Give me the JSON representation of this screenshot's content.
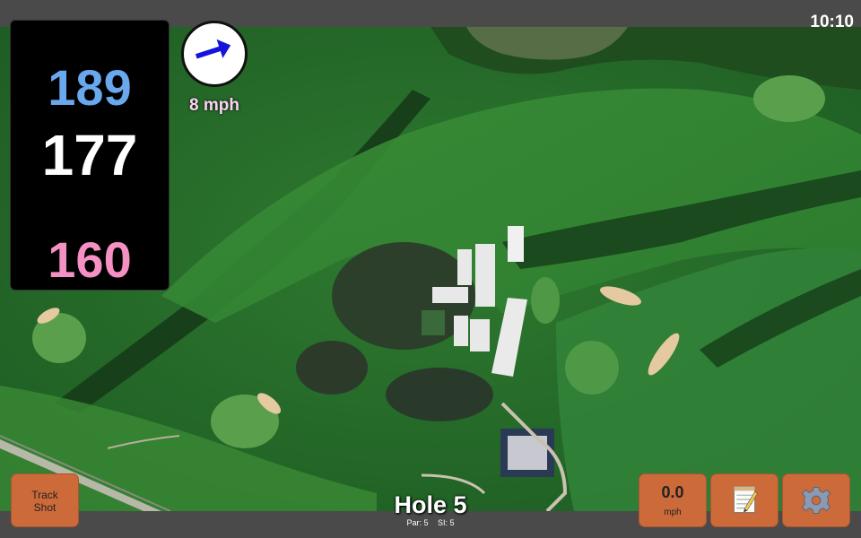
{
  "status_bar": {
    "time": "10:10"
  },
  "yardage": {
    "back": "189",
    "middle": "177",
    "front": "160",
    "colors": {
      "back": "#6aa8ee",
      "middle": "#ffffff",
      "front": "#f590c4"
    }
  },
  "wind": {
    "speed": "8 mph",
    "direction_icon": "arrow-right-up-icon"
  },
  "track_shot": {
    "line1": "Track",
    "line2": "Shot"
  },
  "speed_meter": {
    "value": "0.0",
    "unit": "mph"
  },
  "hole": {
    "title": "Hole 5",
    "par": "Par: 5",
    "si": "SI: 5"
  },
  "toolbar": {
    "notes_icon": "notepad-icon",
    "settings_icon": "gear-icon",
    "button_color": "#cc6a3a"
  }
}
